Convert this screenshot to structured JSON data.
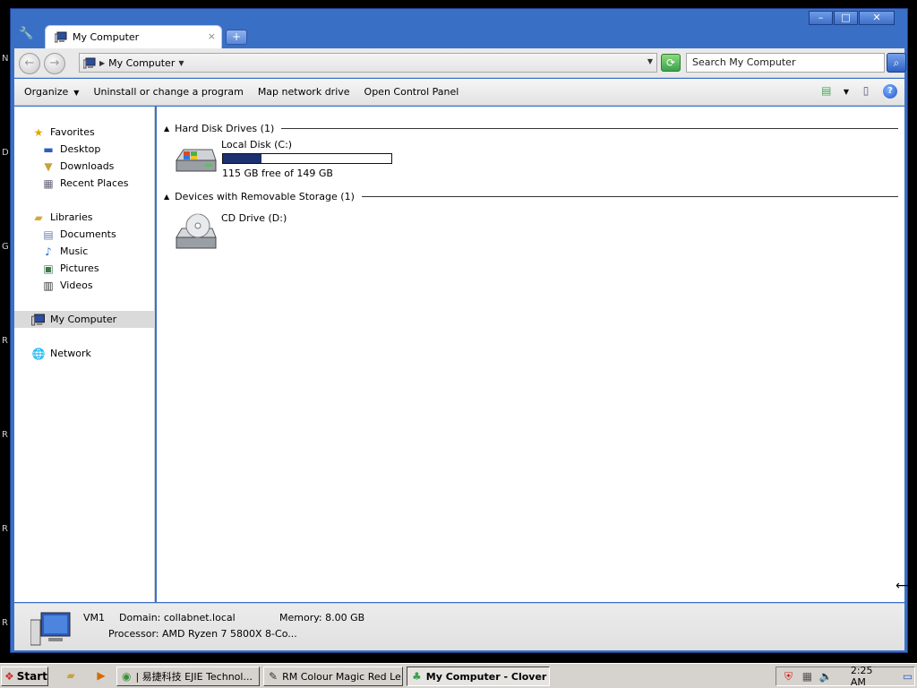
{
  "window": {
    "controls": {
      "minimize": "–",
      "maximize": "□",
      "close": "✕"
    }
  },
  "tab": {
    "title": "My Computer",
    "close": "×",
    "new_tab": "+"
  },
  "address": {
    "back": "←",
    "forward": "→",
    "location": "My Computer",
    "search_placeholder": "Search My Computer"
  },
  "toolbar": {
    "organize": "Organize",
    "uninstall": "Uninstall or change a program",
    "map_drive": "Map network drive",
    "control_panel": "Open Control Panel"
  },
  "nav": {
    "favorites": "Favorites",
    "desktop": "Desktop",
    "downloads": "Downloads",
    "recent": "Recent Places",
    "libraries": "Libraries",
    "documents": "Documents",
    "music": "Music",
    "pictures": "Pictures",
    "videos": "Videos",
    "computer": "My Computer",
    "network": "Network"
  },
  "content": {
    "hdd_header": "Hard Disk Drives (1)",
    "removable_header": "Devices with Removable Storage (1)",
    "local_disk": {
      "name": "Local Disk (C:)",
      "free_text": "115 GB free of 149 GB",
      "free_gb": 115,
      "total_gb": 149
    },
    "cd_drive": {
      "name": "CD Drive (D:)"
    }
  },
  "details": {
    "name": "VM1",
    "domain": "Domain: collabnet.local",
    "memory": "Memory: 8.00 GB",
    "processor": "Processor: AMD Ryzen 7 5800X 8-Co..."
  },
  "taskbar": {
    "start": "Start",
    "tasks": [
      "| 易捷科技 EJIE Technol...",
      "RM Colour Magic  Red Le...",
      "My Computer - Clover"
    ],
    "clock": "2:25 AM"
  },
  "desktop_letters": [
    "N",
    "D",
    "G",
    "R",
    "R",
    "R",
    "R"
  ],
  "colors": {
    "accent": "#3a6fc6",
    "capacity_fill": "#1c2f6f"
  }
}
